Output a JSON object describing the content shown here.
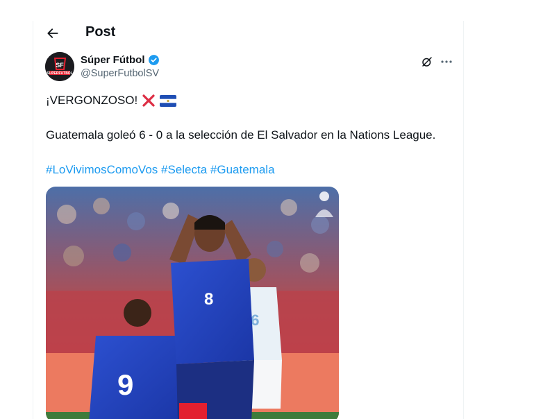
{
  "header": {
    "title": "Post"
  },
  "author": {
    "display_name": "Súper Fútbol",
    "handle": "@SuperFutbolSV",
    "verified": true
  },
  "tweet": {
    "line1": "¡VERGONZOSO!",
    "line1_emojis": [
      "cross-mark-emoji",
      "el-salvador-flag-emoji"
    ],
    "line2": "Guatemala goleó 6 - 0 a la selección de El Salvador en la Nations League.",
    "hashtags": [
      "#LoVivimosComoVos",
      "#Selecta",
      "#Guatemala"
    ]
  },
  "media": {
    "players": [
      {
        "number": "8"
      },
      {
        "number": "9"
      },
      {
        "number": "16"
      }
    ]
  },
  "colors": {
    "link": "#1d9bf0",
    "text": "#0f1419",
    "secondary": "#536471",
    "verified": "#1d9bf0"
  }
}
